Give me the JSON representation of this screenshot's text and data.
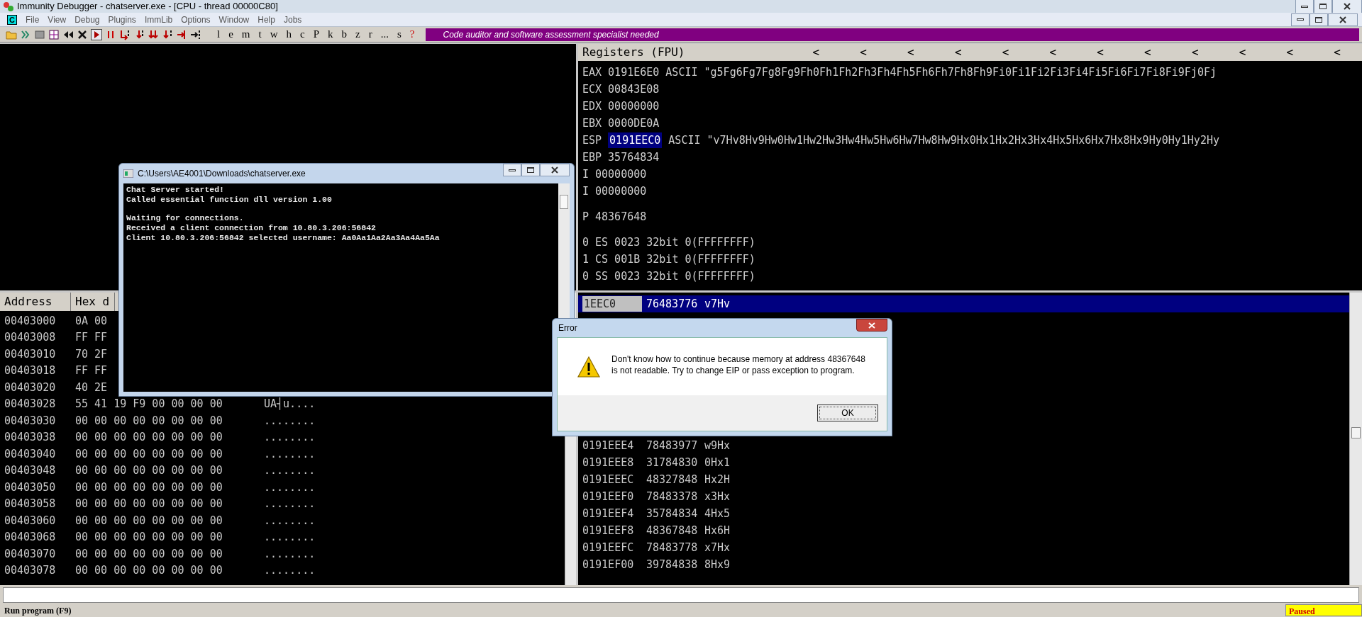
{
  "window": {
    "title": "Immunity Debugger - chatserver.exe - [CPU - thread 00000C80]"
  },
  "menu": {
    "badge": "C",
    "items": [
      "File",
      "View",
      "Debug",
      "Plugins",
      "ImmLib",
      "Options",
      "Window",
      "Help",
      "Jobs"
    ]
  },
  "toolbar": {
    "letters": [
      "l",
      "e",
      "m",
      "t",
      "w",
      "h",
      "c",
      "P",
      "k",
      "b",
      "z",
      "r",
      "...",
      "s",
      "?"
    ],
    "banner": "Code auditor and software assessment specialist needed"
  },
  "registers": {
    "title": "Registers (FPU)",
    "arrows": [
      "<",
      "<",
      "<",
      "<",
      "<",
      "<",
      "<",
      "<",
      "<",
      "<",
      "<",
      "<"
    ],
    "groups": [
      [
        {
          "cells": [
            "EAX",
            "0191E6E0",
            "ASCII \"g5Fg6Fg7Fg8Fg9Fh0Fh1Fh2Fh3Fh4Fh5Fh6Fh7Fh8Fh9Fi0Fi1Fi2Fi3Fi4Fi5Fi6Fi7Fi8Fi9Fj0Fj"
          ],
          "selected": false
        },
        {
          "cells": [
            "ECX",
            "00843E08"
          ],
          "selected": false
        },
        {
          "cells": [
            "EDX",
            "00000000"
          ],
          "selected": false
        },
        {
          "cells": [
            "EBX",
            "0000DE0A"
          ],
          "selected": false
        },
        {
          "cells": [
            "ESP",
            "0191EEC0",
            "ASCII \"v7Hv8Hv9Hw0Hw1Hw2Hw3Hw4Hw5Hw6Hw7Hw8Hw9Hx0Hx1Hx2Hx3Hx4Hx5Hx6Hx7Hx8Hx9Hy0Hy1Hy2Hy"
          ],
          "selected": true
        },
        {
          "cells": [
            "EBP",
            "35764834"
          ],
          "selected": false
        },
        {
          "cells": [
            "I",
            "00000000"
          ],
          "selected": false
        },
        {
          "cells": [
            "I",
            "00000000"
          ],
          "selected": false
        }
      ],
      [
        {
          "cells": [
            "P",
            "48367648"
          ],
          "selected": false
        }
      ],
      [
        {
          "cells": [
            "0",
            "ES 0023 32bit 0(FFFFFFFF)"
          ],
          "selected": false
        },
        {
          "cells": [
            "1",
            "CS 001B 32bit 0(FFFFFFFF)"
          ],
          "selected": false
        },
        {
          "cells": [
            "0",
            "SS 0023 32bit 0(FFFFFFFF)"
          ],
          "selected": false
        }
      ]
    ]
  },
  "dump": {
    "columns": [
      "Address",
      "Hex d"
    ],
    "rows": [
      {
        "cells": [
          "00403000",
          "0A 00"
        ]
      },
      {
        "cells": [
          "00403008",
          "FF FF"
        ]
      },
      {
        "cells": [
          "00403010",
          "70 2F"
        ]
      },
      {
        "cells": [
          "00403018",
          "FF FF"
        ]
      },
      {
        "cells": [
          "00403020",
          "40 2E"
        ]
      },
      {
        "cells": [
          "00403028",
          "55 41 19 F9 00 00 00 00",
          "UA┤u...."
        ]
      },
      {
        "cells": [
          "00403030",
          "00 00 00 00 00 00 00 00",
          "........"
        ]
      },
      {
        "cells": [
          "00403038",
          "00 00 00 00 00 00 00 00",
          "........"
        ]
      },
      {
        "cells": [
          "00403040",
          "00 00 00 00 00 00 00 00",
          "........"
        ]
      },
      {
        "cells": [
          "00403048",
          "00 00 00 00 00 00 00 00",
          "........"
        ]
      },
      {
        "cells": [
          "00403050",
          "00 00 00 00 00 00 00 00",
          "........"
        ]
      },
      {
        "cells": [
          "00403058",
          "00 00 00 00 00 00 00 00",
          "........"
        ]
      },
      {
        "cells": [
          "00403060",
          "00 00 00 00 00 00 00 00",
          "........"
        ]
      },
      {
        "cells": [
          "00403068",
          "00 00 00 00 00 00 00 00",
          "........"
        ]
      },
      {
        "cells": [
          "00403070",
          "00 00 00 00 00 00 00 00",
          "........"
        ]
      },
      {
        "cells": [
          "00403078",
          "00 00 00 00 00 00 00 00",
          "........"
        ]
      }
    ]
  },
  "stack": {
    "groups": [
      [
        {
          "address": "1EEC0",
          "value": "76483776",
          "comment": "v7Hv",
          "selected": true
        }
      ],
      [
        {
          "address": "0191EEE4",
          "value": "78483977",
          "comment": "w9Hx",
          "selected": false
        },
        {
          "address": "0191EEE8",
          "value": "31784830",
          "comment": "0Hx1",
          "selected": false
        },
        {
          "address": "0191EEEC",
          "value": "48327848",
          "comment": "Hx2H",
          "selected": false
        },
        {
          "address": "0191EEF0",
          "value": "78483378",
          "comment": "x3Hx",
          "selected": false
        },
        {
          "address": "0191EEF4",
          "value": "35784834",
          "comment": "4Hx5",
          "selected": false
        },
        {
          "address": "0191EEF8",
          "value": "48367848",
          "comment": "Hx6H",
          "selected": false
        },
        {
          "address": "0191EEFC",
          "value": "78483778",
          "comment": "x7Hx",
          "selected": false
        },
        {
          "address": "0191EF00",
          "value": "39784838",
          "comment": "8Hx9",
          "selected": false
        }
      ]
    ]
  },
  "console_window": {
    "title": "C:\\Users\\AE4001\\Downloads\\chatserver.exe",
    "paragraphs": [
      [
        "Chat Server started!",
        "Called essential function dll version 1.00"
      ],
      [
        "Waiting for connections.",
        "Received a client connection from 10.80.3.206:56842",
        "Client 10.80.3.206:56842 selected username: Aa0Aa1Aa2Aa3Aa4Aa5Aa"
      ]
    ]
  },
  "error_dialog": {
    "title": "Error",
    "message": "Don't know how to continue because memory at address 48367648 is not readable. Try to change EIP or pass exception to program.",
    "button": "OK"
  },
  "status_bar": {
    "message": "Run program (F9)",
    "state": "Paused"
  }
}
